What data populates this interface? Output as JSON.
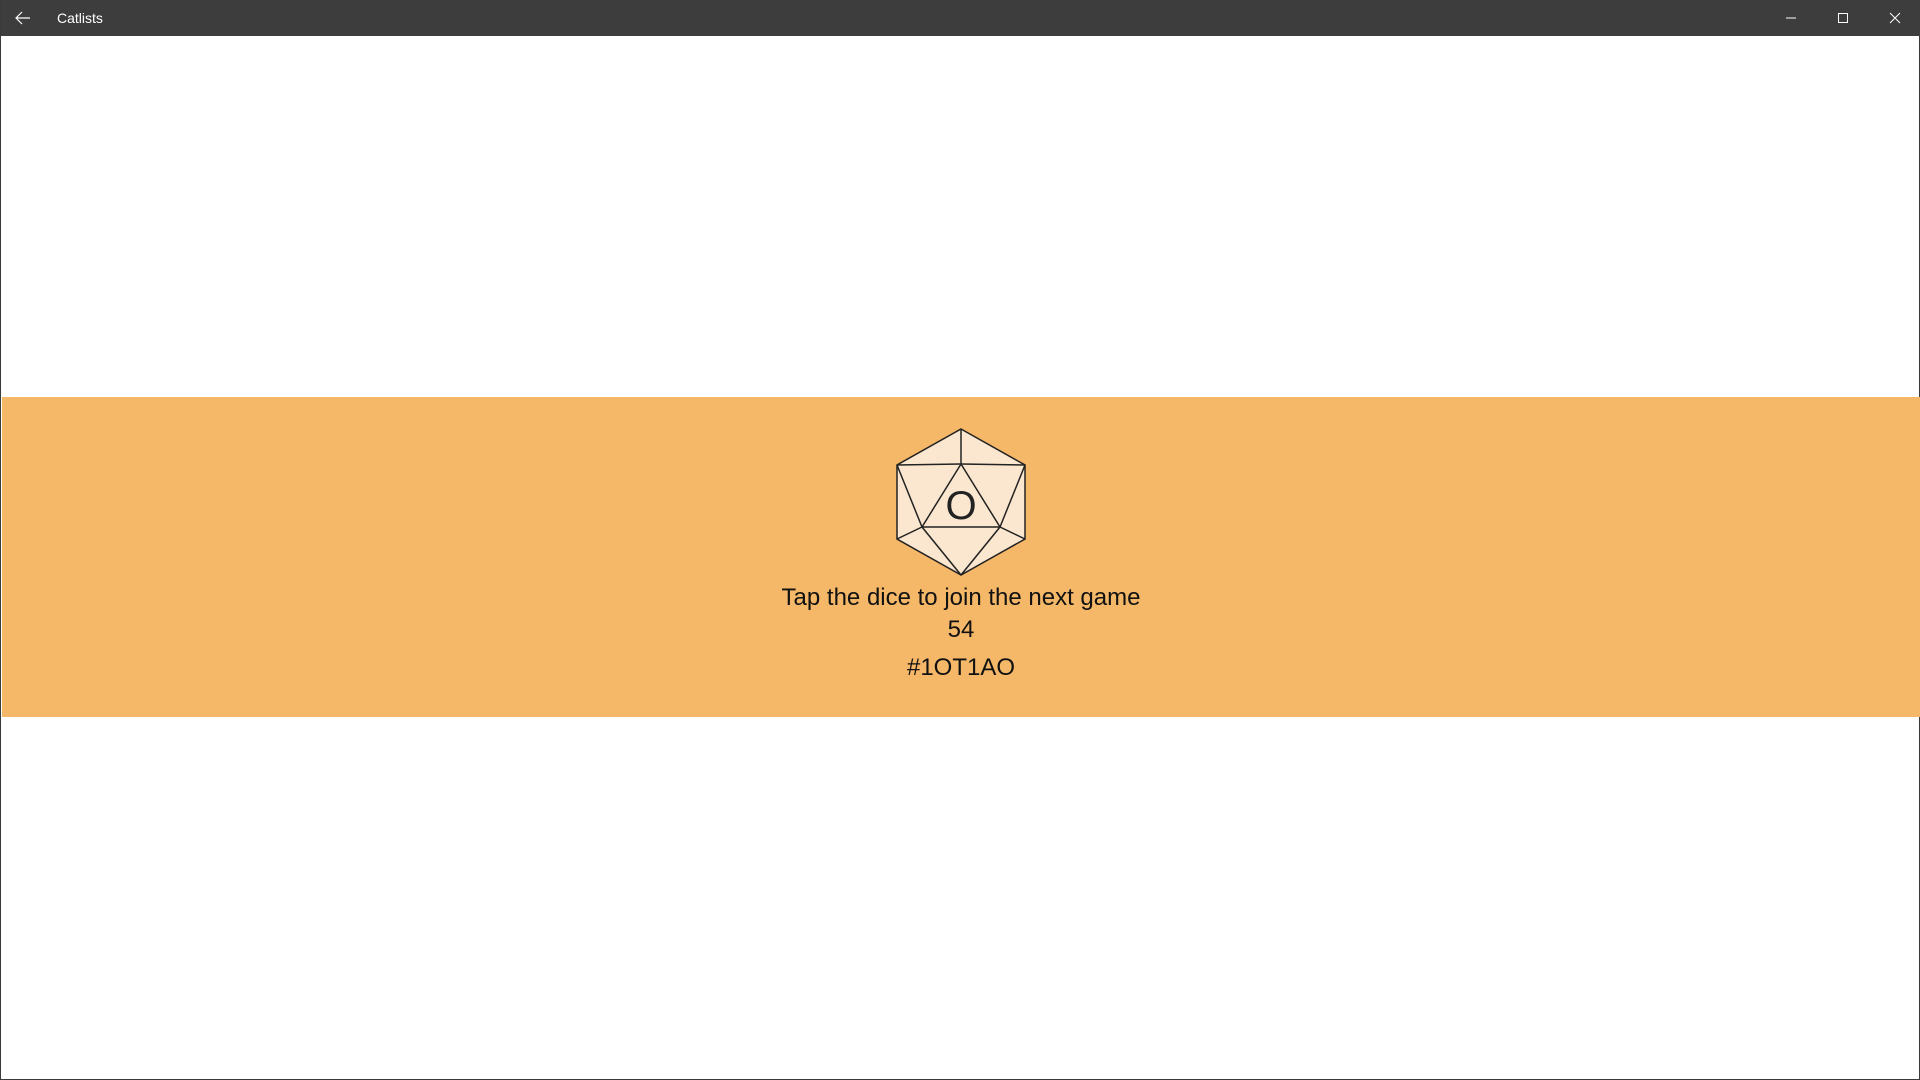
{
  "window": {
    "title": "Catlists"
  },
  "icons": {
    "back": "back-arrow-icon",
    "minimize": "minimize-icon",
    "maximize": "maximize-icon",
    "close": "close-icon"
  },
  "colors": {
    "titlebar": "#3d3d3d",
    "band": "#f5b869",
    "dice_fill": "#fbe7cf",
    "dice_stroke": "#222222"
  },
  "game": {
    "dice_face": "O",
    "prompt": "Tap the dice to join the next game",
    "count": "54",
    "code": "#1OT1AO"
  }
}
